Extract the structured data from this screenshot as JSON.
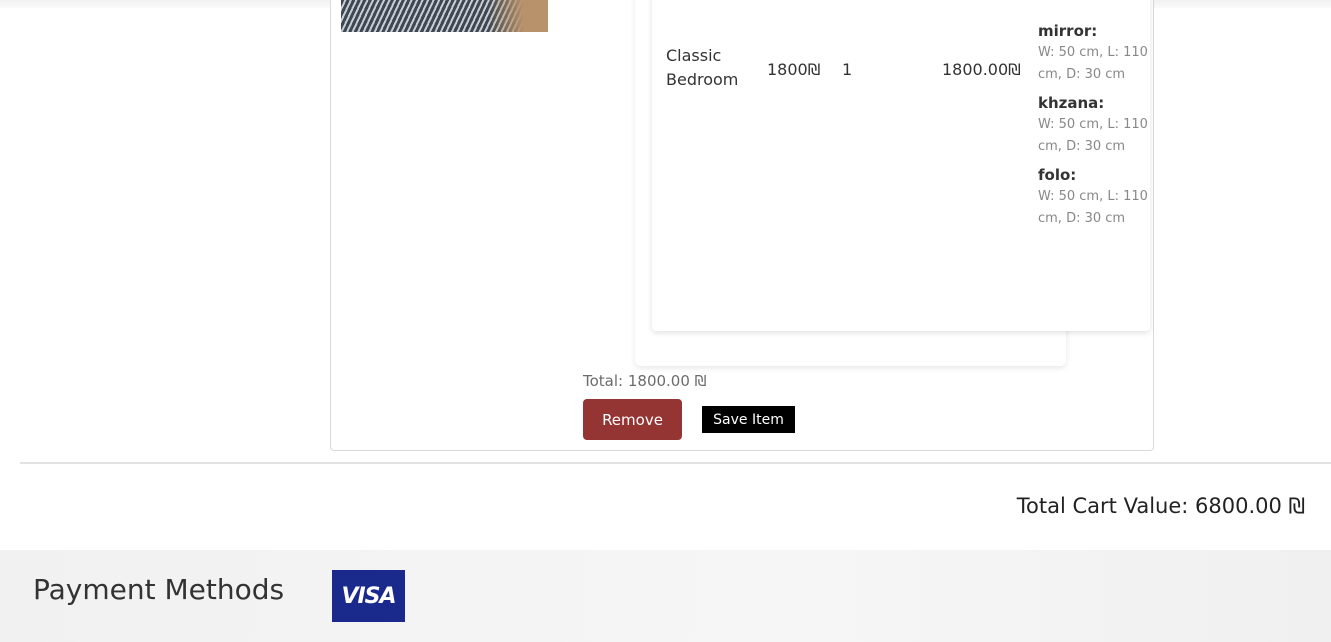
{
  "item": {
    "name": "Classic Bedroom",
    "price": "1800₪",
    "quantity": "1",
    "subtotal": "1800.00₪",
    "dimensions": [
      {
        "label": "mirror:",
        "value": "W: 50 cm, L: 110 cm, D: 30 cm"
      },
      {
        "label": "khzana:",
        "value": "W: 50 cm, L: 110 cm, D: 30 cm"
      },
      {
        "label": "folo:",
        "value": "W: 50 cm, L: 110 cm, D: 30 cm"
      }
    ],
    "total": "Total: 1800.00 ₪",
    "remove_label": "Remove",
    "save_label": "Save Item"
  },
  "cart": {
    "total_value": "Total Cart Value: 6800.00 ₪"
  },
  "payment": {
    "title": "Payment Methods",
    "visa_label": "VISA",
    "visa_color": "#1a2a8c"
  },
  "colors": {
    "remove_button": "#943534",
    "save_button": "#000000"
  }
}
